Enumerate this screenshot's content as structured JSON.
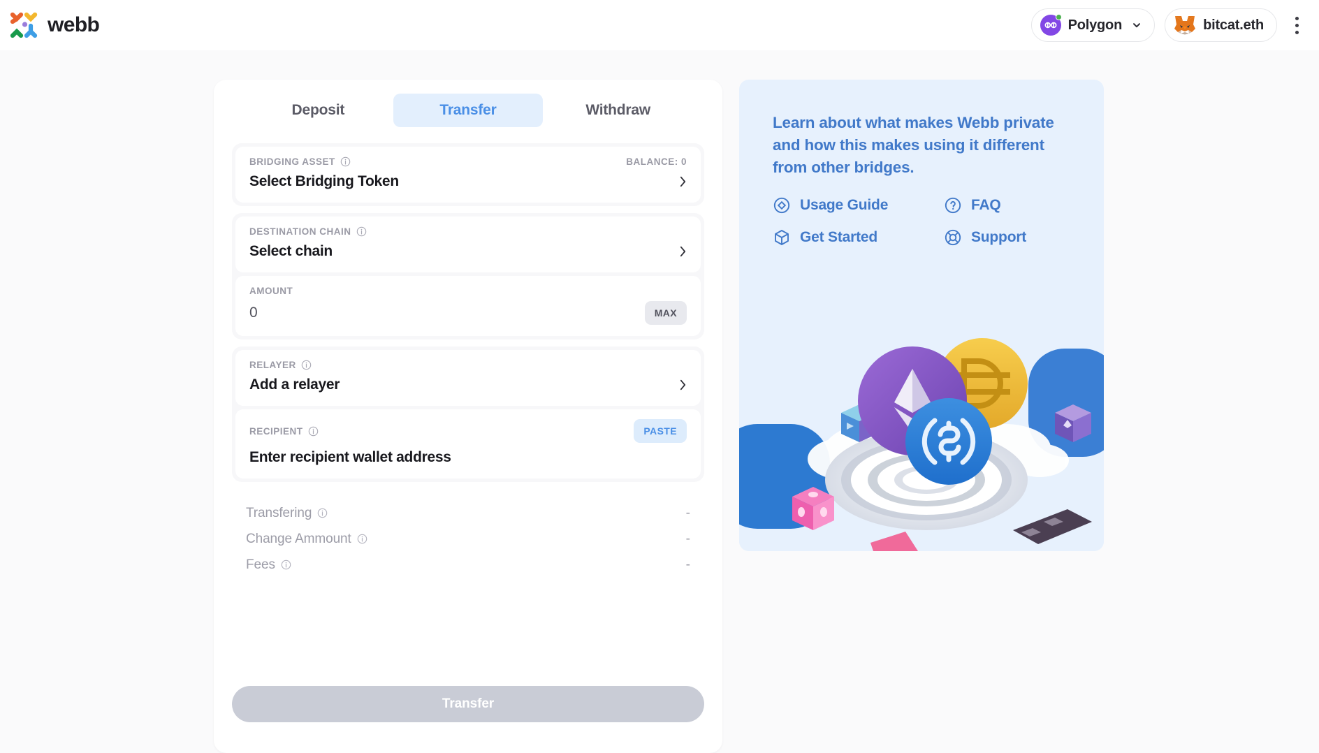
{
  "header": {
    "brand_name": "webb",
    "brand_logo_icon": "webb-logo-icon",
    "network": {
      "label": "Polygon",
      "icon": "polygon-icon",
      "status_dot_color": "#4caf50",
      "caret_icon": "chevron-down-icon"
    },
    "account": {
      "label": "bitcat.eth",
      "icon": "metamask-fox-icon"
    },
    "menu_icon": "kebab-menu-icon"
  },
  "tabs": [
    {
      "label": "Deposit",
      "active": false
    },
    {
      "label": "Transfer",
      "active": true
    },
    {
      "label": "Withdraw",
      "active": false
    }
  ],
  "form": {
    "bridging_asset": {
      "label": "BRIDGING ASSET",
      "info_icon": "info-icon",
      "balance": "BALANCE: 0",
      "value": "Select Bridging Token",
      "chevron_icon": "chevron-right-icon"
    },
    "destination_chain": {
      "label": "DESTINATION CHAIN",
      "info_icon": "info-icon",
      "value": "Select chain",
      "chevron_icon": "chevron-right-icon"
    },
    "amount": {
      "label": "AMOUNT",
      "value": "0",
      "placeholder": "0",
      "max_label": "MAX"
    },
    "relayer": {
      "label": "RELAYER",
      "info_icon": "info-icon",
      "value": "Add a relayer",
      "chevron_icon": "chevron-right-icon"
    },
    "recipient": {
      "label": "RECIPIENT",
      "info_icon": "info-icon",
      "value": "Enter recipient wallet address",
      "placeholder": "Enter recipient wallet address",
      "paste_label": "PASTE"
    }
  },
  "summary": [
    {
      "label": "Transfering",
      "info_icon": "info-icon",
      "value": "-"
    },
    {
      "label": "Change Ammount",
      "info_icon": "info-icon",
      "value": "-"
    },
    {
      "label": "Fees",
      "info_icon": "info-icon",
      "value": "-"
    }
  ],
  "submit": {
    "label": "Transfer",
    "disabled": true
  },
  "info_panel": {
    "text": "Learn about what makes Webb private and how this makes using it different from other bridges.",
    "links": [
      {
        "label": "Usage Guide",
        "icon": "diamond-circle-icon"
      },
      {
        "label": "FAQ",
        "icon": "question-circle-icon"
      },
      {
        "label": "Get Started",
        "icon": "cube-icon"
      },
      {
        "label": "Support",
        "icon": "lifebuoy-icon"
      }
    ],
    "illustration_icon": "crypto-bridge-illustration"
  },
  "colors": {
    "accent_blue": "#4a8fe6",
    "panel_blue_bg": "#e7f1fd",
    "page_bg": "#fafafb",
    "muted_text": "#9a9aa5",
    "disabled_button": "#c9ccd6"
  }
}
